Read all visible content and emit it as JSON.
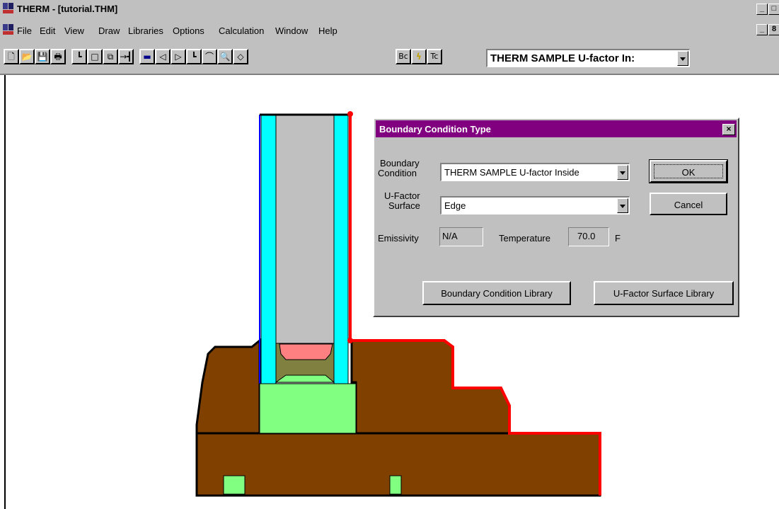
{
  "window": {
    "title": "THERM - [tutorial.THM]",
    "controls": [
      "_",
      "□"
    ]
  },
  "menubar": {
    "items": [
      "File",
      "Edit",
      "View",
      "Draw",
      "Libraries",
      "Options",
      "Calculation",
      "Window",
      "Help"
    ],
    "mdi_controls": [
      "_",
      "8"
    ]
  },
  "toolbar": {
    "buttons": [
      {
        "name": "new-file",
        "glyph": "🗋"
      },
      {
        "name": "open-file",
        "glyph": "📂"
      },
      {
        "name": "save-file",
        "glyph": "💾"
      },
      {
        "name": "print",
        "glyph": "🖶"
      },
      {
        "name": "draw-polygon",
        "glyph": "┗"
      },
      {
        "name": "draw-rectangle",
        "glyph": "□"
      },
      {
        "name": "fill-void",
        "glyph": "⧉"
      },
      {
        "name": "locator",
        "glyph": "→┫"
      },
      {
        "name": "boundary",
        "glyph": "▬"
      },
      {
        "name": "insert-point",
        "glyph": "◁"
      },
      {
        "name": "delete-point",
        "glyph": "▷"
      },
      {
        "name": "move-point",
        "glyph": "┗"
      },
      {
        "name": "arc",
        "glyph": "⌒"
      },
      {
        "name": "zoom",
        "glyph": "🔍"
      },
      {
        "name": "rotate",
        "glyph": "◇"
      },
      {
        "name": "bc",
        "glyph": "Bc"
      },
      {
        "name": "calculate",
        "glyph": "ϟ"
      },
      {
        "name": "tc",
        "glyph": "Tc"
      }
    ],
    "boundary_combo_value": "THERM SAMPLE U-factor In:"
  },
  "dialog": {
    "title": "Boundary Condition Type",
    "close_glyph": "×",
    "boundary_condition_label_1": "Boundary",
    "boundary_condition_label_2": "Condition",
    "boundary_condition_value": "THERM SAMPLE U-factor Inside",
    "ufactor_label_1": "U-Factor",
    "ufactor_label_2": "Surface",
    "ufactor_value": "Edge",
    "emissivity_label": "Emissivity",
    "emissivity_value": "N/A",
    "temperature_label": "Temperature",
    "temperature_value": "70.0",
    "temperature_unit": "F",
    "ok_label": "OK",
    "cancel_label": "Cancel",
    "bc_library_label": "Boundary Condition Library",
    "ufactor_library_label": "U-Factor Surface Library"
  },
  "colors": {
    "frame": "#804000",
    "glass_edge": "#00ffff",
    "glass_gap": "#c0c0c0",
    "spacer_pink": "#ff8080",
    "setting_block": "#80ff80",
    "sealant": "#808040",
    "boundary_red": "#ff0000",
    "dialog_caption": "#800080"
  }
}
